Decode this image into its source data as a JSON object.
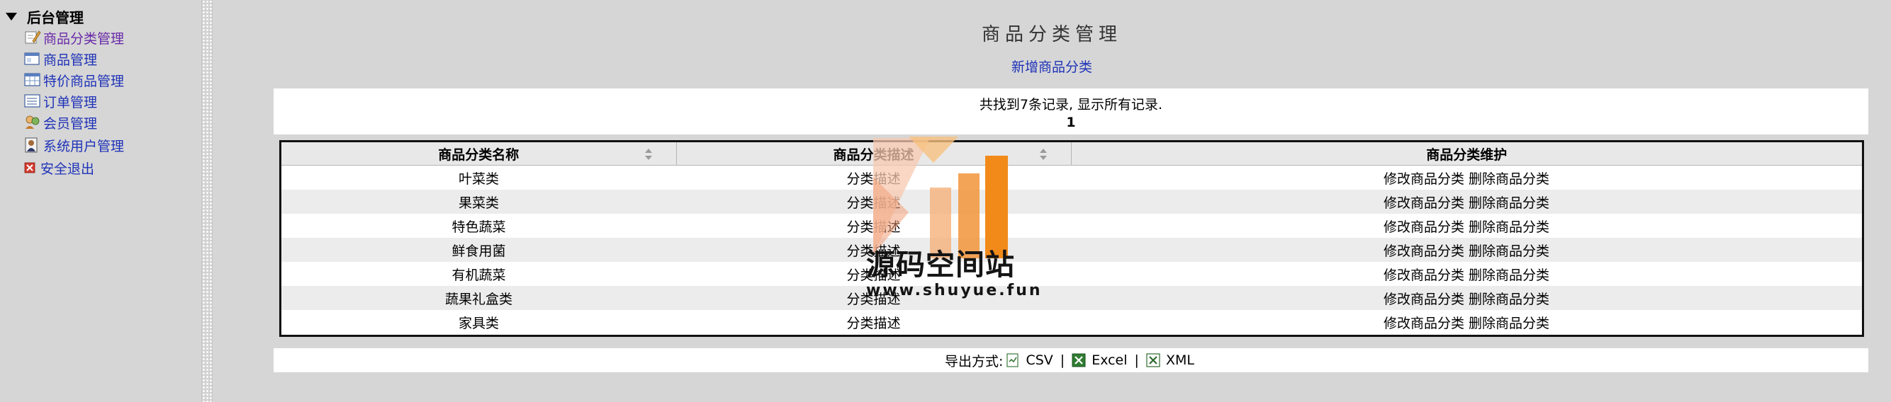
{
  "sidebar": {
    "root_label": "后台管理",
    "items": [
      {
        "label": "商品分类管理",
        "icon": "edit-note-icon"
      },
      {
        "label": "商品管理",
        "icon": "window-icon"
      },
      {
        "label": "特价商品管理",
        "icon": "grid-icon"
      },
      {
        "label": "订单管理",
        "icon": "list-icon"
      },
      {
        "label": "会员管理",
        "icon": "users-icon"
      },
      {
        "label": "系统用户管理",
        "icon": "user-admin-icon"
      },
      {
        "label": "安全退出",
        "icon": "close-icon"
      }
    ]
  },
  "main": {
    "title": "商品分类管理",
    "add_link": "新增商品分类",
    "records_info": "共找到7条记录, 显示所有记录.",
    "page_number": "1",
    "table": {
      "headers": [
        "商品分类名称",
        "商品分类描述",
        "商品分类维护"
      ],
      "rows": [
        {
          "name": "叶菜类",
          "desc": "分类描述",
          "edit": "修改商品分类",
          "delete": "删除商品分类"
        },
        {
          "name": "果菜类",
          "desc": "分类描述",
          "edit": "修改商品分类",
          "delete": "删除商品分类"
        },
        {
          "name": "特色蔬菜",
          "desc": "分类描述",
          "edit": "修改商品分类",
          "delete": "删除商品分类"
        },
        {
          "name": "鲜食用菌",
          "desc": "分类描述",
          "edit": "修改商品分类",
          "delete": "删除商品分类"
        },
        {
          "name": "有机蔬菜",
          "desc": "分类描述",
          "edit": "修改商品分类",
          "delete": "删除商品分类"
        },
        {
          "name": "蔬果礼盒类",
          "desc": "分类描述",
          "edit": "修改商品分类",
          "delete": "删除商品分类"
        },
        {
          "name": "家具类",
          "desc": "分类描述",
          "edit": "修改商品分类",
          "delete": "删除商品分类"
        }
      ]
    },
    "export": {
      "label": "导出方式:",
      "options": [
        "CSV",
        "Excel",
        "XML"
      ],
      "separator": "|"
    }
  },
  "watermark": {
    "title": "源码空间站",
    "url": "www.shuyue.fun"
  },
  "colors": {
    "link": "#1f33b8",
    "visited_link": "#6a2aa8",
    "background": "#d6d6d6",
    "watermark_orange": "#f28a1a"
  }
}
